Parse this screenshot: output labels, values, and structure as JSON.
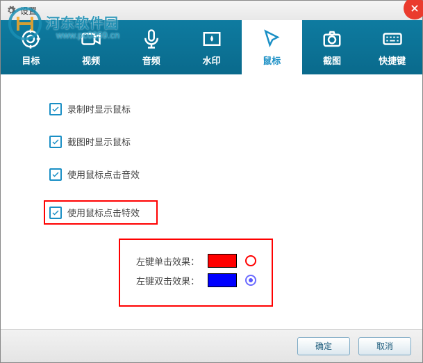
{
  "window": {
    "title": "设置"
  },
  "watermark": {
    "text": "河东软件园",
    "url": "www.pc0359.cn"
  },
  "tabs": [
    {
      "label": "目标"
    },
    {
      "label": "视频"
    },
    {
      "label": "音频"
    },
    {
      "label": "水印"
    },
    {
      "label": "鼠标"
    },
    {
      "label": "截图"
    },
    {
      "label": "快捷键"
    }
  ],
  "options": {
    "show_cursor_record": "录制时显示鼠标",
    "show_cursor_screenshot": "截图时显示鼠标",
    "click_sound": "使用鼠标点击音效",
    "click_effect": "使用鼠标点击特效"
  },
  "effects": {
    "left_single": "左键单击效果：",
    "left_double": "左键双击效果：",
    "single_color": "#ff0000",
    "double_color": "#0000ff"
  },
  "footer": {
    "ok": "确定",
    "cancel": "取消"
  }
}
